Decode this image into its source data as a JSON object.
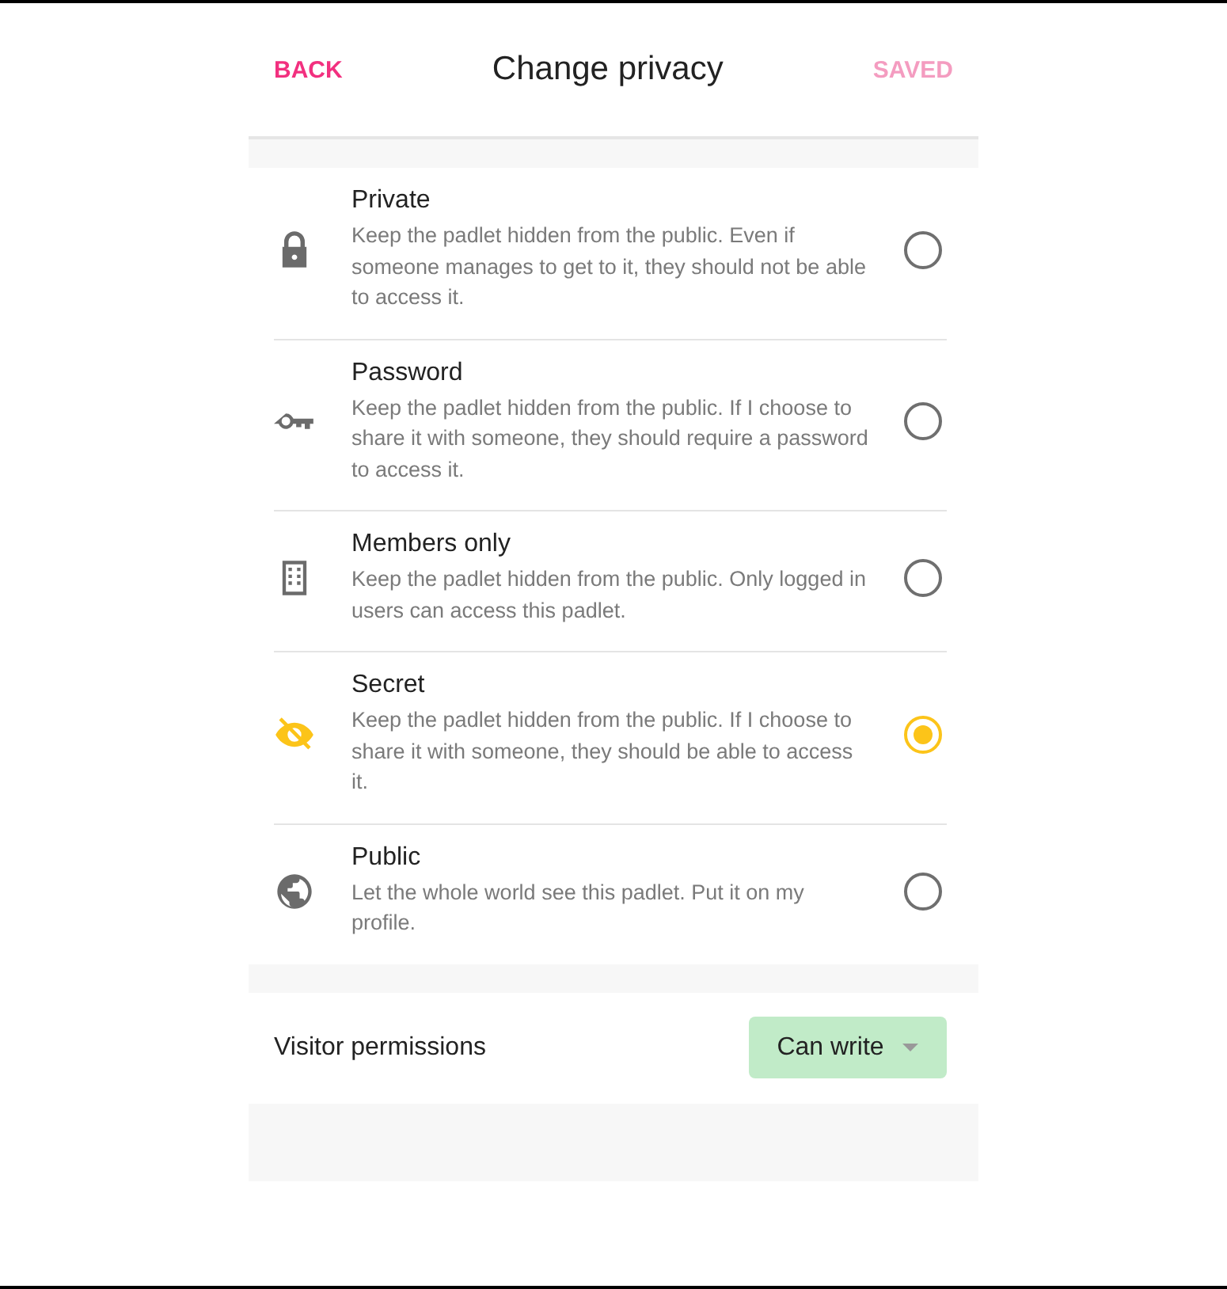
{
  "header": {
    "back": "BACK",
    "title": "Change privacy",
    "saved": {
      "label": "SAVED",
      "disabled": true
    }
  },
  "options": [
    {
      "kind": "lock",
      "title": "Private",
      "description": "Keep the padlet hidden from the public. Even if someone manages to get to it, they should not be able to access it.",
      "selected": false
    },
    {
      "kind": "key",
      "title": "Password",
      "description": "Keep the padlet hidden from the public. If I choose to share it with someone, they should require a password to access it.",
      "selected": false
    },
    {
      "kind": "building",
      "title": "Members only",
      "description": "Keep the padlet hidden from the public. Only logged in users can access this padlet.",
      "selected": false
    },
    {
      "kind": "eye-off",
      "title": "Secret",
      "description": "Keep the padlet hidden from the public. If I choose to share it with someone, they should be able to access it.",
      "selected": true
    },
    {
      "kind": "globe",
      "title": "Public",
      "description": "Let the whole world see this padlet. Put it on my profile.",
      "selected": false
    }
  ],
  "visitor_permissions": {
    "label": "Visitor permissions",
    "value": "Can write"
  }
}
